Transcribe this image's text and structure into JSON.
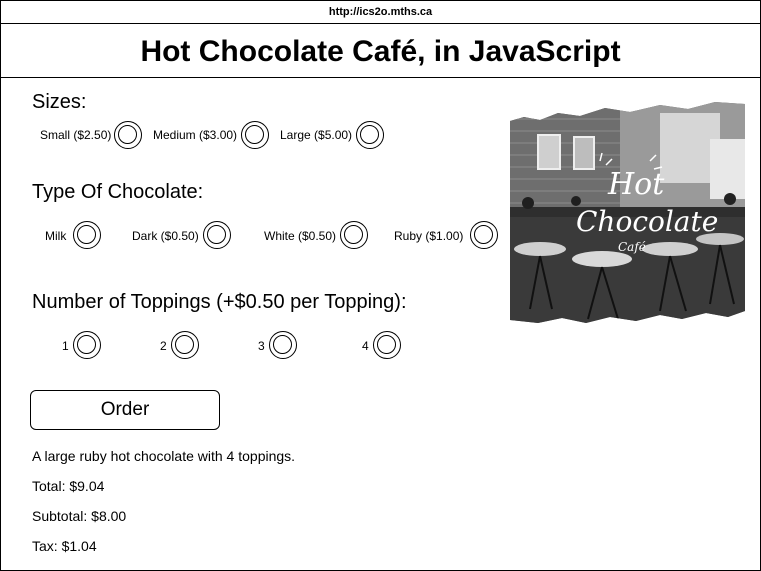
{
  "browser": {
    "url": "http://ics2o.mths.ca"
  },
  "page": {
    "title": "Hot Chocolate Café, in JavaScript"
  },
  "sizes": {
    "heading": "Sizes:",
    "options": [
      "Small ($2.50)",
      "Medium ($3.00)",
      "Large ($5.00)"
    ]
  },
  "chocolate": {
    "heading": "Type Of Chocolate:",
    "options": [
      "Milk",
      "Dark ($0.50)",
      "White ($0.50)",
      "Ruby ($1.00)"
    ]
  },
  "toppings": {
    "heading": "Number of Toppings (+$0.50 per Topping):",
    "options": [
      "1",
      "2",
      "3",
      "4"
    ]
  },
  "order_button": {
    "label": "Order"
  },
  "output": {
    "summary": "A large ruby hot chocolate with 4 toppings.",
    "total": "Total: $9.04",
    "subtotal": "Subtotal: $8.00",
    "tax": "Tax: $1.04"
  },
  "image": {
    "logo_line1": "Hot",
    "logo_line2": "Chocolate",
    "logo_line3": "Café"
  },
  "colors": {
    "border": "#000000",
    "background": "#ffffff"
  }
}
